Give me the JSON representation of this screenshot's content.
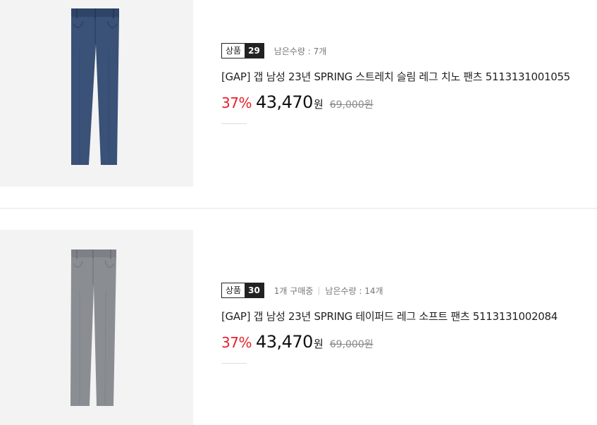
{
  "products": [
    {
      "badge_label": "상품",
      "badge_number": "29",
      "remaining": "남은수량 : 7개",
      "title": "[GAP] 갭 남성 23년 SPRING 스트레치 슬림 레그 치노 팬츠 5113131001055",
      "discount": "37%",
      "sale_price": "43,470",
      "sale_unit": "원",
      "original_price": "69,000원",
      "image_icon": "navy-chino-pants-image",
      "pants_color": "#3a5178"
    },
    {
      "badge_label": "상품",
      "badge_number": "30",
      "buying": "1개 구매중",
      "remaining": "남은수량 : 14개",
      "title": "[GAP] 갭 남성 23년 SPRING 테이퍼드 레그 소프트 팬츠 5113131002084",
      "discount": "37%",
      "sale_price": "43,470",
      "sale_unit": "원",
      "original_price": "69,000원",
      "image_icon": "gray-tapered-pants-image",
      "pants_color": "#8a8d92"
    }
  ],
  "colors": {
    "discount": "#e8202b",
    "thumb_bg": "#f3f3f3"
  }
}
